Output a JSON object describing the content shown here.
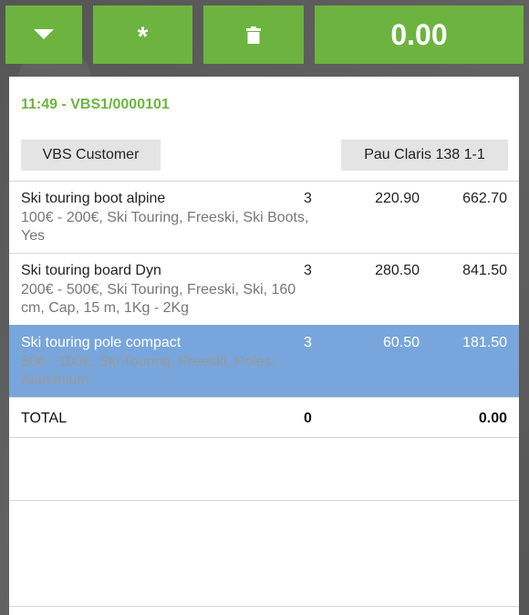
{
  "toolbar": {
    "dropdown_icon": "caret-down-icon",
    "asterisk_label": "*",
    "delete_icon": "trash-icon",
    "total_display": "0.00",
    "accent_color": "#6cb43f"
  },
  "ticket": {
    "header": "11:49 - VBS1/0000101",
    "customer": "VBS Customer",
    "location": "Pau Claris 138 1-1"
  },
  "lines": [
    {
      "name": "Ski touring boot alpine",
      "attrs": "100€ - 200€, Ski Touring, Freeski, Ski Boots, Yes",
      "qty": "3",
      "price": "220.90",
      "amount": "662.70",
      "selected": false
    },
    {
      "name": "Ski touring board Dyn",
      "attrs": "200€ - 500€, Ski Touring, Freeski, Ski, 160 cm, Cap, 15 m, 1Kg - 2Kg",
      "qty": "3",
      "price": "280.50",
      "amount": "841.50",
      "selected": false
    },
    {
      "name": "Ski touring pole compact",
      "attrs": "50€ - 100€, Ski Touring, Freeski, Poles, Aluminium",
      "qty": "3",
      "price": "60.50",
      "amount": "181.50",
      "selected": true
    }
  ],
  "totals": {
    "label": "TOTAL",
    "qty": "0",
    "amount": "0.00"
  },
  "selection_color": "#78a6dc"
}
